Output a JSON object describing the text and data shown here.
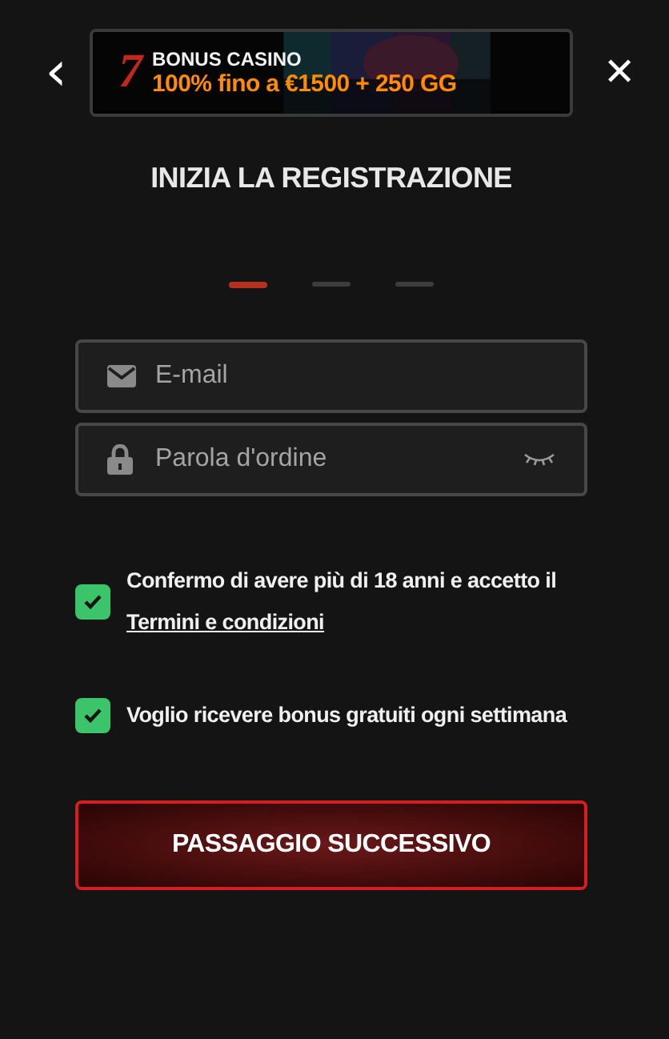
{
  "header": {
    "back_icon": "‹",
    "close_icon": "✕"
  },
  "banner": {
    "logo": "7",
    "title": "BONUS CASINO",
    "offer": "100% fino a €1500 + 250 GG"
  },
  "title": "INIZIA LA REGISTRAZIONE",
  "steps": [
    {
      "selected": true
    },
    {
      "selected": false
    },
    {
      "selected": false
    }
  ],
  "fields": [
    {
      "kind": "email",
      "placeholder": "E-mail"
    },
    {
      "kind": "password",
      "placeholder": "Parola d'ordine"
    }
  ],
  "checkboxes": [
    {
      "text": "Confermo di avere più di 18 anni e accetto il",
      "link": "Termini e condizioni",
      "checked": true
    },
    {
      "text": "Voglio ricevere bonus gratuiti ogni settimana",
      "checked": true
    }
  ],
  "button": "PASSAGGIO SUCCESSIVO"
}
